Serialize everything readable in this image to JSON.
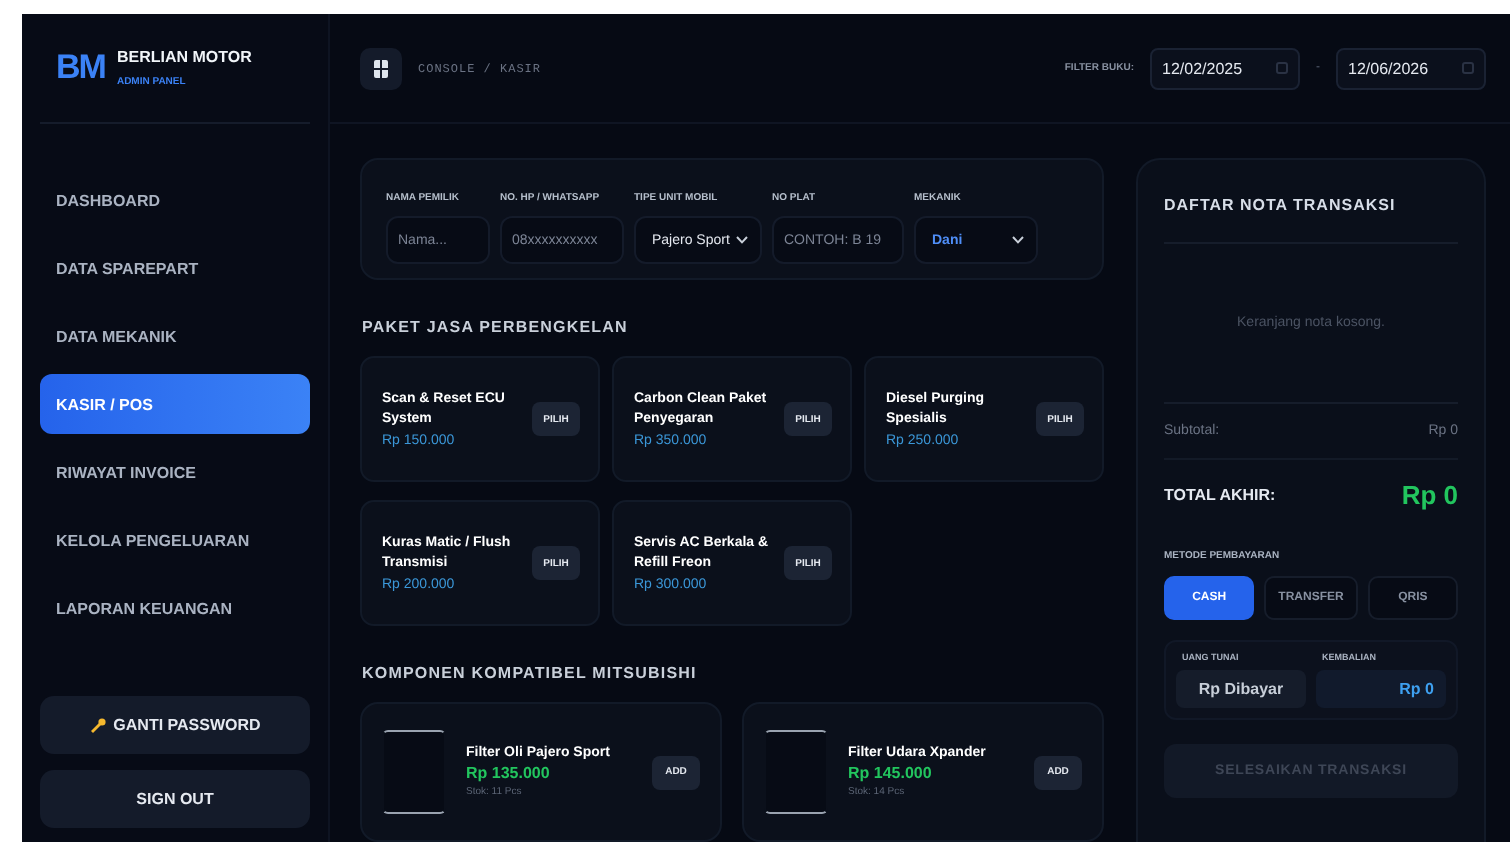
{
  "brand": {
    "logo": "BM",
    "title": "BERLIAN MOTOR",
    "subtitle": "ADMIN PANEL"
  },
  "nav": [
    {
      "label": "DASHBOARD",
      "selected": false
    },
    {
      "label": "DATA SPAREPART",
      "selected": false
    },
    {
      "label": "DATA MEKANIK",
      "selected": false
    },
    {
      "label": "KASIR / POS",
      "selected": true
    },
    {
      "label": "RIWAYAT INVOICE",
      "selected": false
    },
    {
      "label": "KELOLA PENGELUARAN",
      "selected": false
    },
    {
      "label": "LAPORAN KEUANGAN",
      "selected": false
    }
  ],
  "sidebar_buttons": [
    {
      "label": "GANTI PASSWORD",
      "kind": "password"
    },
    {
      "label": "SIGN OUT",
      "kind": "plain"
    }
  ],
  "breadcrumb": "CONSOLE / KASIR",
  "filter": {
    "label": "FILTER BUKU:",
    "from": "12/02/2025",
    "separator": "-",
    "to": "12/06/2026"
  },
  "customer_form": [
    {
      "label": "NAMA PEMILIK",
      "kind": "input",
      "placeholder": "Nama..."
    },
    {
      "label": "NO. HP / WHATSAPP",
      "kind": "input",
      "placeholder": "08xxxxxxxxxx"
    },
    {
      "label": "TIPE UNIT MOBIL",
      "kind": "select",
      "value": "Pajero Sport"
    },
    {
      "label": "NO PLAT",
      "kind": "input",
      "placeholder": "CONTOH: B 19"
    },
    {
      "label": "MEKANIK",
      "kind": "select",
      "value": "Dani"
    }
  ],
  "services": {
    "title": "PAKET JASA PERBENGKELAN",
    "items": [
      {
        "name": "Scan & Reset ECU System",
        "price": "Rp 150.000",
        "button": "PILIH"
      },
      {
        "name": "Carbon Clean Paket Penyegaran",
        "price": "Rp 350.000",
        "button": "PILIH"
      },
      {
        "name": "Diesel Purging Spesialis",
        "price": "Rp 250.000",
        "button": "PILIH"
      },
      {
        "name": "Kuras Matic / Flush Transmisi",
        "price": "Rp 200.000",
        "button": "PILIH"
      },
      {
        "name": "Servis AC Berkala & Refill Freon",
        "price": "Rp 300.000",
        "button": "PILIH"
      }
    ]
  },
  "parts": {
    "title": "KOMPONEN KOMPATIBEL MITSUBISHI",
    "items": [
      {
        "name": "Filter Oli Pajero Sport",
        "price": "Rp 135.000",
        "stock": "Stok: 11 Pcs",
        "button": "ADD"
      },
      {
        "name": "Filter Udara Xpander",
        "price": "Rp 145.000",
        "stock": "Stok: 14 Pcs",
        "button": "ADD"
      }
    ]
  },
  "invoice": {
    "title": "DAFTAR NOTA TRANSAKSI",
    "empty_text": "Keranjang nota kosong.",
    "subtotal_label": "Subtotal:",
    "subtotal_value": "Rp 0",
    "total_label": "TOTAL AKHIR:",
    "total_value": "Rp 0",
    "payment_label": "METODE PEMBAYARAN",
    "methods": [
      {
        "label": "CASH",
        "selected": true
      },
      {
        "label": "TRANSFER",
        "selected": false
      },
      {
        "label": "QRIS",
        "selected": false
      }
    ],
    "cash_label": "UANG TUNAI",
    "cash_placeholder": "Rp Dibayar",
    "change_label": "KEMBALIAN",
    "change_value": "Rp 0",
    "submit": {
      "label": "SELESAIKAN TRANSAKSI",
      "disabled": true
    }
  }
}
